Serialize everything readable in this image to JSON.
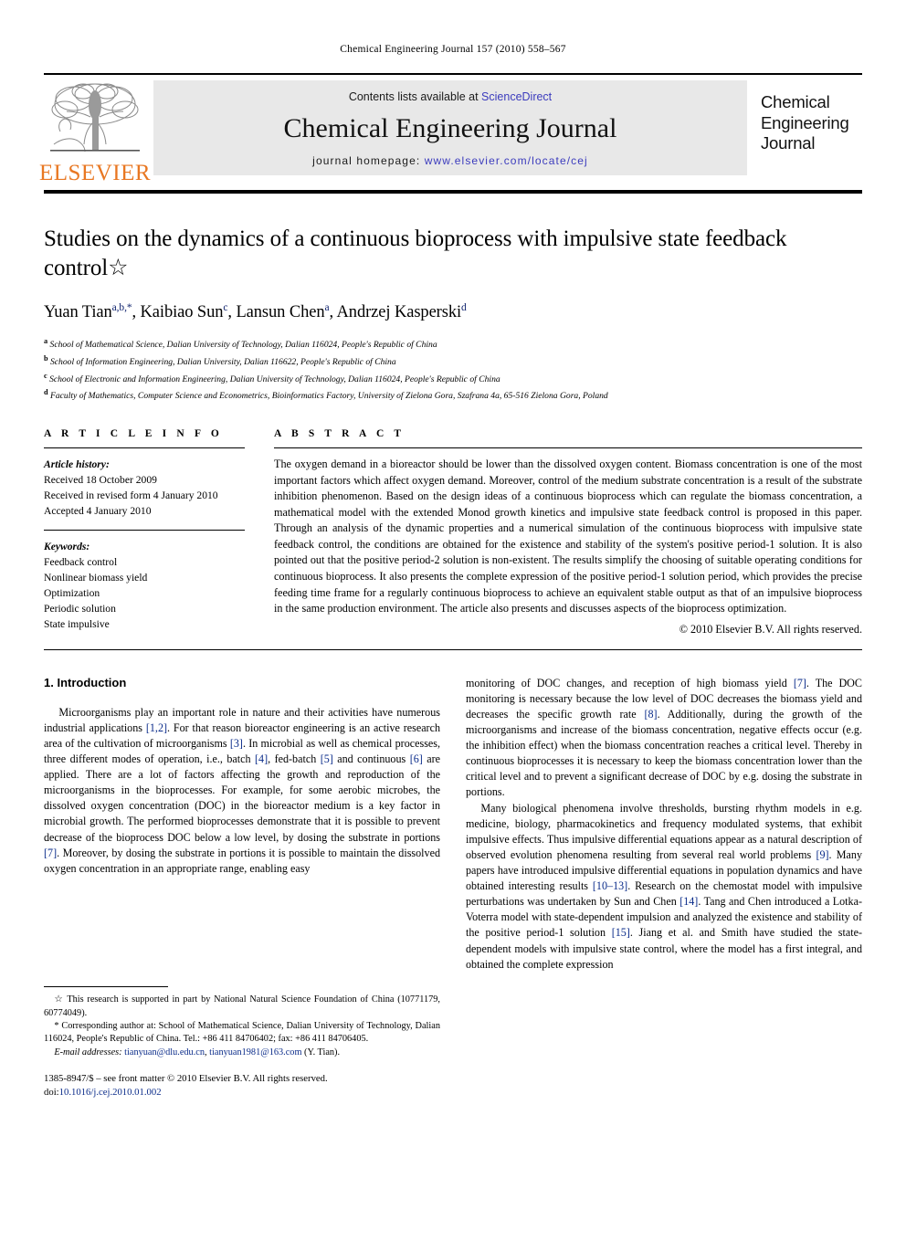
{
  "running_head": "Chemical Engineering Journal 157 (2010) 558–567",
  "masthead": {
    "publisher_name": "ELSEVIER",
    "contents_prefix": "Contents lists available at ",
    "contents_link": "ScienceDirect",
    "journal_title": "Chemical Engineering Journal",
    "homepage_prefix": "journal homepage: ",
    "homepage_url": "www.elsevier.com/locate/cej",
    "cover_line1": "Chemical",
    "cover_line2": "Engineering",
    "cover_line3": "Journal",
    "link_color": "#3b3bbd",
    "brand_color": "#E87722"
  },
  "article": {
    "title": "Studies on the dynamics of a continuous bioprocess with impulsive state feedback control☆",
    "authors_html": "Yuan Tian<sup>a,b,</sup><sup>*</sup>, Kaibiao Sun<sup>c</sup>, Lansun Chen<sup>a</sup>, Andrzej Kasperski<sup>d</sup>",
    "affiliations": [
      {
        "marker": "a",
        "text": "School of Mathematical Science, Dalian University of Technology, Dalian 116024, People's Republic of China"
      },
      {
        "marker": "b",
        "text": "School of Information Engineering, Dalian University, Dalian 116622, People's Republic of China"
      },
      {
        "marker": "c",
        "text": "School of Electronic and Information Engineering, Dalian University of Technology, Dalian 116024, People's Republic of China"
      },
      {
        "marker": "d",
        "text": "Faculty of Mathematics, Computer Science and Econometrics, Bioinformatics Factory, University of Zielona Gora, Szafrana 4a, 65-516 Zielona Gora, Poland"
      }
    ]
  },
  "article_info": {
    "heading": "A R T I C L E  I N F O",
    "history_label": "Article history:",
    "history": [
      "Received 18 October 2009",
      "Received in revised form 4 January 2010",
      "Accepted 4 January 2010"
    ],
    "keywords_label": "Keywords:",
    "keywords": [
      "Feedback control",
      "Nonlinear biomass yield",
      "Optimization",
      "Periodic solution",
      "State impulsive"
    ]
  },
  "abstract": {
    "heading": "A B S T R A C T",
    "text": "The oxygen demand in a bioreactor should be lower than the dissolved oxygen content. Biomass concentration is one of the most important factors which affect oxygen demand. Moreover, control of the medium substrate concentration is a result of the substrate inhibition phenomenon. Based on the design ideas of a continuous bioprocess which can regulate the biomass concentration, a mathematical model with the extended Monod growth kinetics and impulsive state feedback control is proposed in this paper. Through an analysis of the dynamic properties and a numerical simulation of the continuous bioprocess with impulsive state feedback control, the conditions are obtained for the existence and stability of the system's positive period-1 solution. It is also pointed out that the positive period-2 solution is non-existent. The results simplify the choosing of suitable operating conditions for continuous bioprocess. It also presents the complete expression of the positive period-1 solution period, which provides the precise feeding time frame for a regularly continuous bioprocess to achieve an equivalent stable output as that of an impulsive bioprocess in the same production environment. The article also presents and discusses aspects of the bioprocess optimization.",
    "copyright": "© 2010 Elsevier B.V. All rights reserved."
  },
  "body": {
    "section_title": "1. Introduction",
    "left_paragraphs": [
      "Microorganisms play an important role in nature and their activities have numerous industrial applications <span class=\"ref\">[1,2]</span>. For that reason bioreactor engineering is an active research area of the cultivation of microorganisms <span class=\"ref\">[3]</span>. In microbial as well as chemical processes, three different modes of operation, i.e., batch <span class=\"ref\">[4]</span>, fed-batch <span class=\"ref\">[5]</span> and continuous <span class=\"ref\">[6]</span> are applied. There are a lot of factors affecting the growth and reproduction of the microorganisms in the bioprocesses. For example, for some aerobic microbes, the dissolved oxygen concentration (DOC) in the bioreactor medium is a key factor in microbial growth. The performed bioprocesses demonstrate that it is possible to prevent decrease of the bioprocess DOC below a low level, by dosing the substrate in portions <span class=\"ref\">[7]</span>. Moreover, by dosing the substrate in portions it is possible to maintain the dissolved oxygen concentration in an appropriate range, enabling easy"
    ],
    "right_paragraphs": [
      "monitoring of DOC changes, and reception of high biomass yield <span class=\"ref\">[7]</span>. The DOC monitoring is necessary because the low level of DOC decreases the biomass yield and decreases the specific growth rate <span class=\"ref\">[8]</span>. Additionally, during the growth of the microorganisms and increase of the biomass concentration, negative effects occur (e.g. the inhibition effect) when the biomass concentration reaches a critical level. Thereby in continuous bioprocesses it is necessary to keep the biomass concentration lower than the critical level and to prevent a significant decrease of DOC by e.g. dosing the substrate in portions.",
      "Many biological phenomena involve thresholds, bursting rhythm models in e.g. medicine, biology, pharmacokinetics and frequency modulated systems, that exhibit impulsive effects. Thus impulsive differential equations appear as a natural description of observed evolution phenomena resulting from several real world problems <span class=\"ref\">[9]</span>. Many papers have introduced impulsive differential equations in population dynamics and have obtained interesting results <span class=\"ref\">[10–13]</span>. Research on the chemostat model with impulsive perturbations was undertaken by Sun and Chen <span class=\"ref\">[14]</span>. Tang and Chen introduced a Lotka-Voterra model with state-dependent impulsion and analyzed the existence and stability of the positive period-1 solution <span class=\"ref\">[15]</span>. Jiang et al. and Smith have studied the state-dependent models with impulsive state control, where the model has a first integral, and obtained the complete expression"
    ]
  },
  "footnotes": {
    "funding": "☆ This research is supported in part by National Natural Science Foundation of China (10771179, 60774049).",
    "corresponding": "* Corresponding author at: School of Mathematical Science, Dalian University of Technology, Dalian 116024, People's Republic of China. Tel.: +86 411 84706402; fax: +86 411 84706405.",
    "email_label": "E-mail addresses:",
    "email_1": "tianyuan@dlu.edu.cn",
    "email_2": "tianyuan1981@163.com",
    "email_suffix": "(Y. Tian).",
    "imprint": "1385-8947/$ – see front matter © 2010 Elsevier B.V. All rights reserved.",
    "doi_label": "doi:",
    "doi_value": "10.1016/j.cej.2010.01.002"
  }
}
